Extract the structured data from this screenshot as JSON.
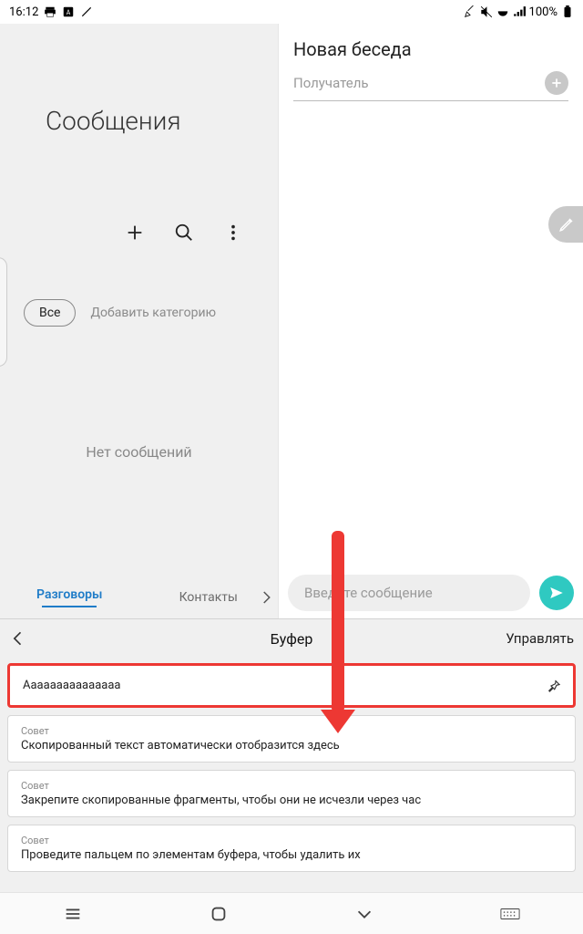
{
  "status": {
    "time": "16:12",
    "battery": "100%"
  },
  "left": {
    "title": "Сообщения",
    "chip_all": "Все",
    "add_category": "Добавить категорию",
    "empty": "Нет сообщений",
    "tabs": {
      "conversations": "Разговоры",
      "contacts": "Контакты"
    }
  },
  "right": {
    "new_conversation": "Новая беседа",
    "recipient": "Получатель",
    "message_placeholder": "Введите сообщение"
  },
  "clipboard": {
    "title": "Буфер",
    "manage": "Управлять",
    "tip_label": "Совет",
    "items": [
      {
        "text": "Ааааааааааааааа"
      },
      {
        "tip": true,
        "text": "Скопированный текст автоматически отобразится здесь"
      },
      {
        "tip": true,
        "text": "Закрепите скопированные фрагменты, чтобы они не исчезли через час"
      },
      {
        "tip": true,
        "text": "Проведите пальцем по элементам буфера, чтобы удалить их"
      }
    ]
  }
}
